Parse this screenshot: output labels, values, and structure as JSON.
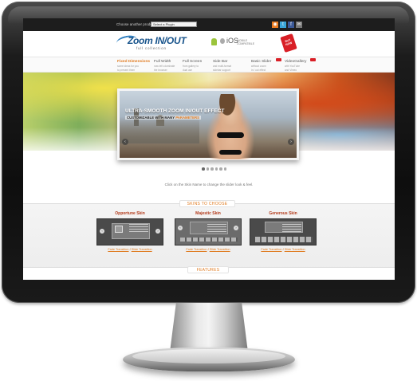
{
  "topbar": {
    "choose_label": "Choose another product:",
    "select_value": "Select a Plugin",
    "social_icons": [
      "rss-icon",
      "twitter-icon",
      "facebook-icon",
      "chat-icon"
    ]
  },
  "header": {
    "logo_main": "Zoom IN/OUT",
    "logo_sub": "full collection",
    "platform_text": "iOS",
    "platform_compat": "MOBILE COMPATIBLE",
    "sale_tag": "BUY NOW"
  },
  "nav": {
    "items": [
      {
        "title": "Fixed Dimensions",
        "desc1": "some ideas for you",
        "desc2": "to present them",
        "active": true,
        "is_new": false
      },
      {
        "title": "Full Width",
        "desc1": "now let's dominate",
        "desc2": "the browser",
        "active": false,
        "is_new": false
      },
      {
        "title": "Full Screen",
        "desc1": "from gallery to",
        "desc2": "dual use",
        "active": false,
        "is_new": false
      },
      {
        "title": "Side Bar",
        "desc1": "and multi-format",
        "desc2": "sidebar support",
        "active": false,
        "is_new": false
      },
      {
        "title": "Basic Slider",
        "desc1": "without zoom",
        "desc2": "in / out effect",
        "active": false,
        "is_new": true
      },
      {
        "title": "VideoGallery",
        "desc1": "with YouTube",
        "desc2": "and Vimeo",
        "active": false,
        "is_new": true
      }
    ]
  },
  "slider": {
    "title": "ULTRA-SMOOTH ZOOM IN/OUT EFFECT",
    "subtitle_pre": "CUSTOMIZABLE WITH MANY ",
    "subtitle_hl": "PARAMETERS",
    "prev": "‹",
    "next": "›",
    "bullet_count": 6,
    "active_bullet": 0
  },
  "instruction": "Click on the Skin Name to change the slider look & feel.",
  "skins_section": {
    "label": "SKINS TO CHOOSE",
    "skins": [
      {
        "name": "Opportune Skin",
        "fade": "Fade Transition",
        "sep": " / ",
        "slide": "Slide Transition"
      },
      {
        "name": "Majestic Skin",
        "fade": "Fade Transition",
        "sep": " / ",
        "slide": "Slide Transition"
      },
      {
        "name": "Generous Skin",
        "fade": "Fade Transition",
        "sep": " / ",
        "slide": "Slide Transition"
      }
    ]
  },
  "features_label": "FEATURES",
  "colors": {
    "accent": "#e07a1f",
    "brand_blue": "#17538b",
    "sale_red": "#d91f26"
  }
}
